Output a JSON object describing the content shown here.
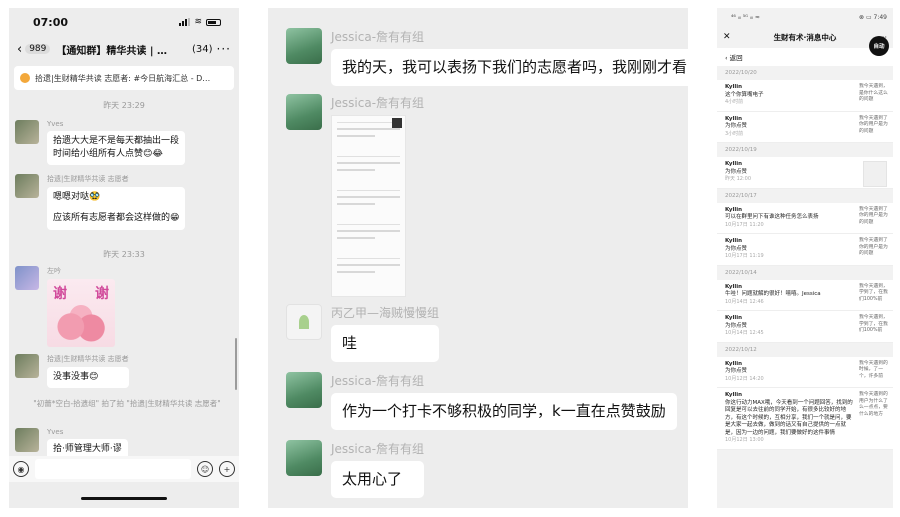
{
  "panel_a": {
    "status": {
      "time": "07:00"
    },
    "nav": {
      "back_count": "989",
      "title": "【通知群】精华共读 | …",
      "member_count": "(34)",
      "more": "···"
    },
    "pinned": "拾遗|生财精华共读 志愿者: #今日航海汇总 - D…",
    "timestamps": [
      "昨天 23:29",
      "昨天 23:33"
    ],
    "messages": [
      {
        "sender": "Yves",
        "text1": "拾遗大大是不是每天都抽出一段",
        "text2": "时间给小组所有人点赞😊😂"
      },
      {
        "sender": "拾遗|生财精华共读 志愿者",
        "text1": "嗯嗯对哒🥸",
        "text2": "应该所有志愿者都会这样做的😁"
      },
      {
        "sender": "左吟",
        "sticker_left": "谢",
        "sticker_right": "谢"
      },
      {
        "sender": "拾遗|生财精华共读 志愿者",
        "text1": "没事没事😊"
      },
      {
        "sender": "Yves",
        "text1": "拾·师管理大师·谬"
      }
    ],
    "system_note": "\"初蕾*空白-拾遗组\" 拍了拍 \"拾遗|生财精华共读 志愿者\""
  },
  "panel_b": {
    "messages": [
      {
        "sender": "Jessica-詹有有组",
        "text": "我的天，我可以表扬下我们的志愿者吗，我刚刚才看到"
      },
      {
        "sender": "Jessica-詹有有组"
      },
      {
        "sender": "丙乙甲—海贼慢慢组",
        "text": "哇"
      },
      {
        "sender": "Jessica-詹有有组",
        "text": "作为一个打卡不够积极的同学，k一直在点赞鼓励"
      },
      {
        "sender": "Jessica-詹有有组",
        "text": "太用心了"
      }
    ]
  },
  "panel_c": {
    "status": {
      "left": "⁴⁶ ᵢₗₗ ⁵ᴳ ᵢₗₗ ≈",
      "right": "⊗ ▭ 7:49"
    },
    "header": {
      "close": "✕",
      "title": "生财有术·消息中心",
      "more": "···"
    },
    "auto_badge": "自动",
    "back": "‹ 返回",
    "groups": [
      {
        "date": "2022/10/20",
        "items": [
          {
            "name": "Kyllin",
            "text": "这个你算嘴电子",
            "time": "4小时前",
            "side": "我今天遇到，是你什么这么的问题"
          },
          {
            "name": "Kyllin",
            "text": "为你点赞",
            "time": "3小时前",
            "side": "我今天遇到了你的用户是为的问题"
          }
        ]
      },
      {
        "date": "2022/10/19",
        "items": [
          {
            "name": "Kyllin",
            "text": "为你点赞",
            "time": "昨天 12:00",
            "side": ""
          }
        ]
      },
      {
        "date": "2022/10/17",
        "items": [
          {
            "name": "Kyllin",
            "text": "可以在群里问下有谁这种任务怎么表扬",
            "time": "10月17日 11:20",
            "side": "我今天遇到了你的用户是为的问题"
          },
          {
            "name": "Kyllin",
            "text": "为你点赞",
            "time": "10月17日 11:19",
            "side": "我今天遇到了你的用户是为的问题"
          }
        ]
      },
      {
        "date": "2022/10/14",
        "items": [
          {
            "name": "Kyllin",
            "text": "牛哇！问题就解的很好！嘻嘻。Jessica",
            "time": "10月14日 12:46",
            "side": "我今天遇到，学到了，在我们100%前"
          },
          {
            "name": "Kyllin",
            "text": "为你点赞",
            "time": "10月14日 12:45",
            "side": "我今天遇到，学到了，在我们100%前"
          }
        ]
      },
      {
        "date": "2022/10/12",
        "items": [
          {
            "name": "Kyllin",
            "text": "为你点赞",
            "time": "10月12日 14:20",
            "side": "我今天遇到的时候，了一个，许多前"
          },
          {
            "name": "Kyllin",
            "text": "你这行动力MAX哦，今天看到一个问题回答，找到的回复是可以去往前的同学开始，有很多比较好的地方，有这个时候的，互相分享，我们一个就是问，要是大家一起去做，做到的话又有自己提供的一点就是，因为一边的问题，我们要做好的这件事情",
            "time": "10月12日 13:00",
            "side": "我今天遇到的用户为什么了么一点点，要什么的地方"
          }
        ]
      }
    ]
  }
}
